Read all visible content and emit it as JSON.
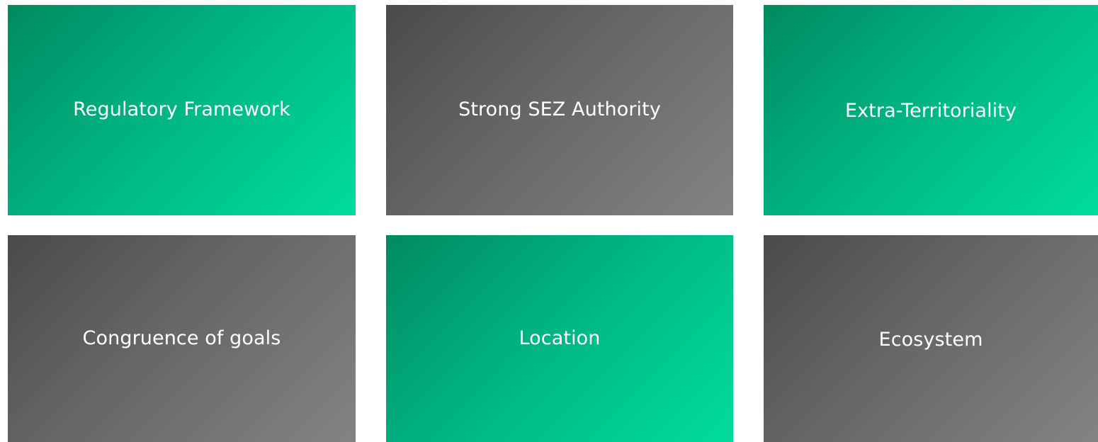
{
  "cards": [
    {
      "label": "Regulatory Framework",
      "theme": "green"
    },
    {
      "label": "Strong SEZ Authority",
      "theme": "gray"
    },
    {
      "label": "Extra-Territoriality",
      "theme": "green"
    },
    {
      "label": "Congruence of goals",
      "theme": "gray"
    },
    {
      "label": "Location",
      "theme": "green"
    },
    {
      "label": "Ecosystem",
      "theme": "gray"
    }
  ],
  "colors": {
    "green_start": "#008a5f",
    "green_end": "#00dc9e",
    "gray_start": "#4a4a4a",
    "gray_end": "#838383",
    "text": "#ffffff"
  }
}
